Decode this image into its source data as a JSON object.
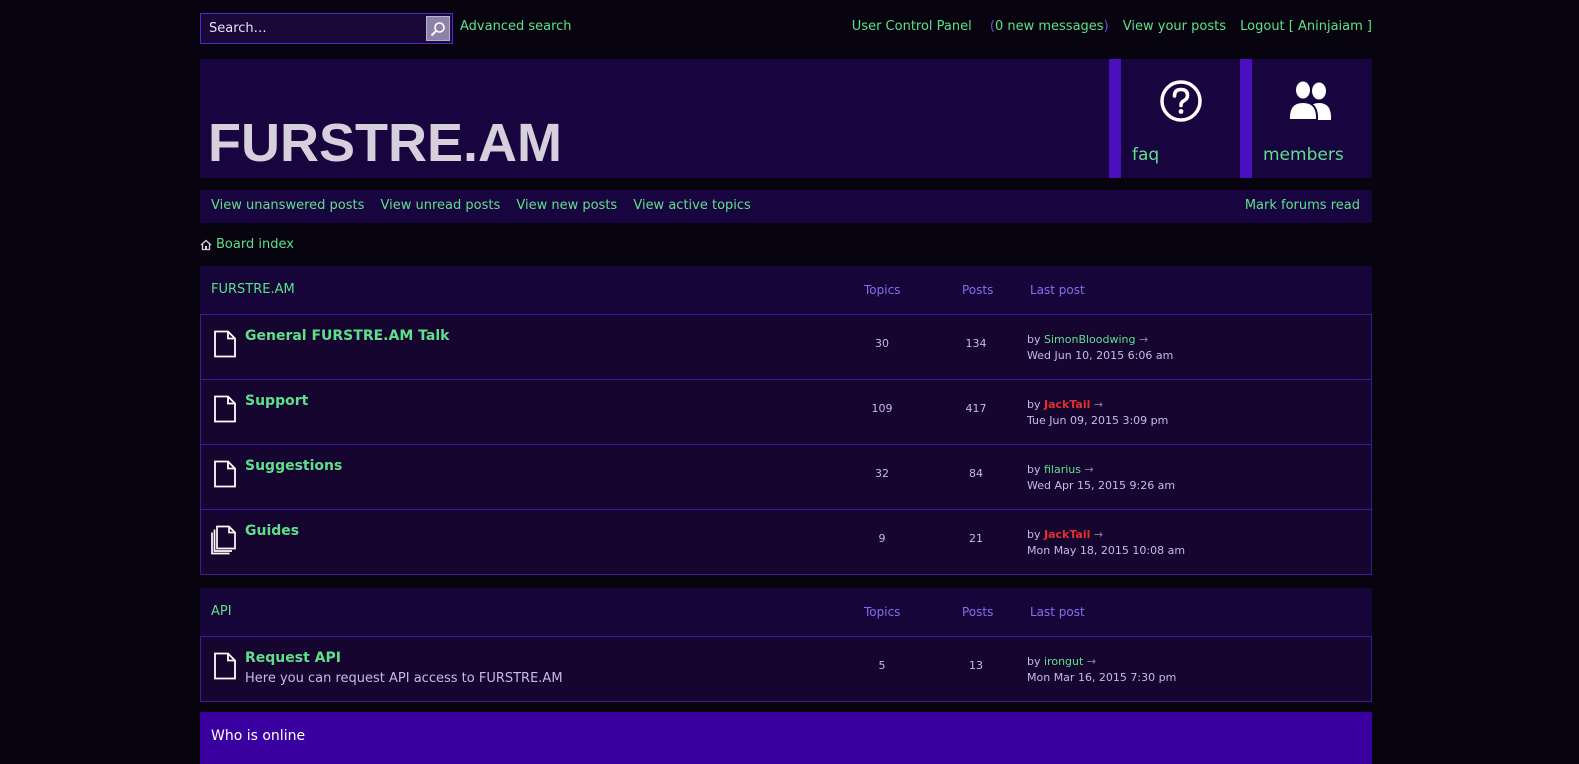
{
  "search": {
    "placeholder": "Search…",
    "advanced_label": "Advanced search"
  },
  "user_menu": {
    "control_panel": "User Control Panel",
    "paren_open": "(",
    "messages": "0 new messages",
    "paren_close": ")",
    "view_posts": "View your posts",
    "logout": "Logout [ Aninjaiam ]"
  },
  "header": {
    "site_title": "FURSTRE.AM",
    "tiles": [
      {
        "label": "faq",
        "icon": "help-icon"
      },
      {
        "label": "members",
        "icon": "members-icon"
      }
    ]
  },
  "nav": {
    "links": [
      "View unanswered posts",
      "View unread posts",
      "View new posts",
      "View active topics"
    ],
    "mark_read": "Mark forums read"
  },
  "breadcrumb": {
    "label": "Board index",
    "icon": "home-icon"
  },
  "categories": [
    {
      "name": "FURSTRE.AM",
      "col_topics": "Topics",
      "col_posts": "Posts",
      "col_last": "Last post",
      "forums": [
        {
          "name": "General FURSTRE.AM Talk",
          "desc": "",
          "topics": "30",
          "posts": "134",
          "last_by": "by",
          "last_author": "SimonBloodwing",
          "last_date": "Wed Jun 10, 2015 6:06 am",
          "icon": "document-icon"
        },
        {
          "name": "Support",
          "desc": "",
          "topics": "109",
          "posts": "417",
          "last_by": "by",
          "last_author": "JackTail",
          "last_date": "Tue Jun 09, 2015 3:09 pm",
          "icon": "document-icon"
        },
        {
          "name": "Suggestions",
          "desc": "",
          "topics": "32",
          "posts": "84",
          "last_by": "by",
          "last_author": "filarius",
          "last_date": "Wed Apr 15, 2015 9:26 am",
          "icon": "document-icon"
        },
        {
          "name": "Guides",
          "desc": "",
          "topics": "9",
          "posts": "21",
          "last_by": "by",
          "last_author": "JackTail",
          "last_date": "Mon May 18, 2015 10:08 am",
          "icon": "documents-stack-icon"
        }
      ]
    },
    {
      "name": "API",
      "col_topics": "Topics",
      "col_posts": "Posts",
      "col_last": "Last post",
      "forums": [
        {
          "name": "Request API",
          "desc": "Here you can request API access to FURSTRE.AM",
          "topics": "5",
          "posts": "13",
          "last_by": "by",
          "last_author": "irongut",
          "last_date": "Mon Mar 16, 2015 7:30 pm",
          "icon": "document-icon"
        }
      ]
    }
  ],
  "colors": {
    "accent_green": "#5de08a",
    "author_red": "#e2302c",
    "bg_panel": "#180540",
    "tile_border": "#4a10c0",
    "online_bar": "#3a00a0"
  },
  "online": {
    "title": "Who is online"
  }
}
